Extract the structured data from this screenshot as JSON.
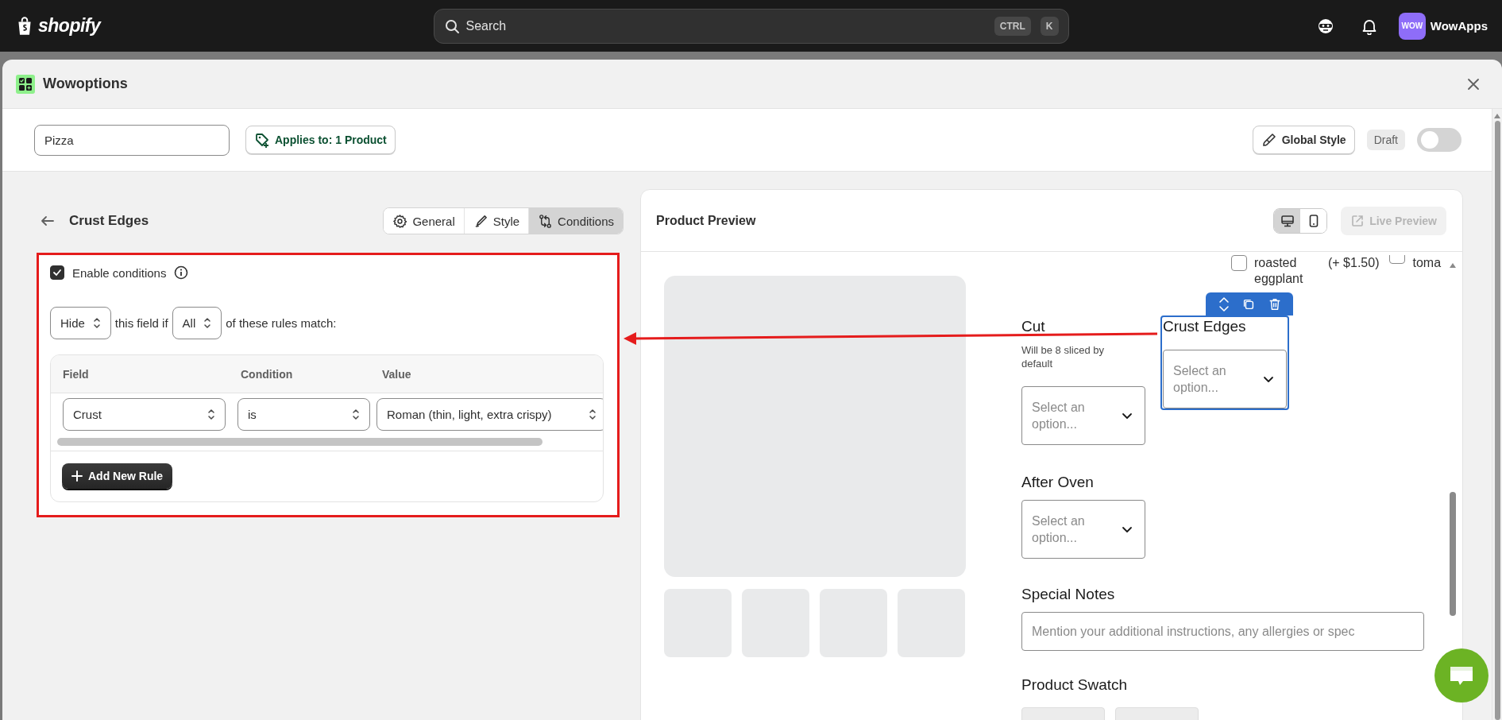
{
  "top_bar": {
    "logo_text": "shopify",
    "search": {
      "placeholder": "Search",
      "shortcut": [
        "CTRL",
        "K"
      ]
    },
    "account": {
      "avatar": "WOW",
      "name": "WowApps"
    }
  },
  "modal": {
    "title": "Wowoptions"
  },
  "toolbar": {
    "name_field": {
      "value": "Pizza"
    },
    "applies_button": "Applies to: 1 Product",
    "global_style_button": "Global Style",
    "status_badge": "Draft",
    "publish_toggle": {
      "on": false
    }
  },
  "editor": {
    "title": "Crust Edges",
    "tabs": [
      {
        "label": "General",
        "kind": "gear",
        "selected": false
      },
      {
        "label": "Style",
        "kind": "brush",
        "selected": false
      },
      {
        "label": "Conditions",
        "kind": "swap",
        "selected": true
      }
    ],
    "enable_conditions": {
      "label": "Enable conditions",
      "checked": true
    },
    "rule_sentence": {
      "action": "Hide",
      "text_1": "this field if",
      "match": "All",
      "text_2": "of these rules match:"
    },
    "rules_table": {
      "columns": [
        "Field",
        "Condition",
        "Value"
      ],
      "rows": [
        [
          "Crust",
          "is",
          "Roman (thin, light, extra crispy)"
        ]
      ]
    },
    "add_rule_button": "Add New Rule"
  },
  "preview": {
    "title": "Product Preview",
    "devices": [
      {
        "kind": "desktop",
        "selected": true
      },
      {
        "kind": "mobile",
        "selected": false
      }
    ],
    "live_preview_button": {
      "label": "Live Preview",
      "disabled": true
    },
    "toppings": [
      {
        "label": "roasted eggplant",
        "price": "(+ $1.50)",
        "checked": false
      },
      {
        "label": "toma",
        "checked": false
      }
    ],
    "field_rows": [
      [
        {
          "kind": "select",
          "label": "Cut",
          "help": "Will be 8 sliced by default",
          "placeholder": "Select an option...",
          "selected": false
        },
        {
          "kind": "select",
          "label": "Crust Edges",
          "placeholder": "Select an option...",
          "selected": true
        }
      ],
      [
        {
          "kind": "select",
          "label": "After Oven",
          "placeholder": "Select an option...",
          "selected": false
        }
      ],
      [
        {
          "kind": "text",
          "label": "Special Notes",
          "placeholder": "Mention your additional instructions, any allergies or spec"
        }
      ],
      [
        {
          "kind": "swatch",
          "label": "Product Swatch"
        }
      ]
    ]
  }
}
